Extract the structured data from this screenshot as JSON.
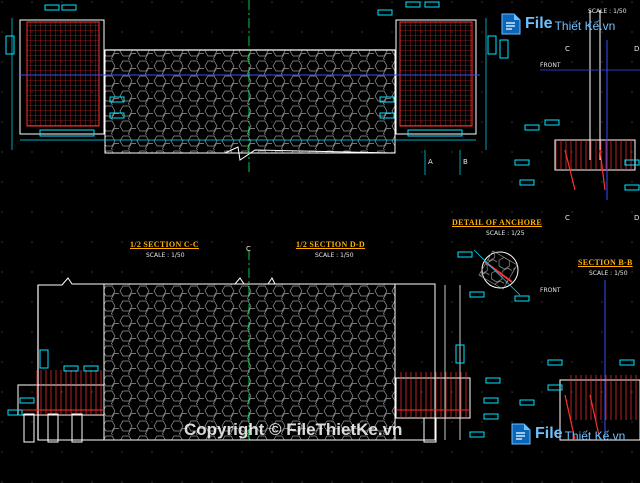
{
  "drawing": {
    "labels": {
      "section_cc": "1/2 SECTION C-C",
      "section_dd": "1/2 SECTION D-D",
      "section_cc_scale": "SCALE : 1/50",
      "section_dd_scale": "SCALE : 1/50",
      "anchore_title": "DETAIL OF ANCHORE",
      "anchore_scale": "SCALE : 1/25",
      "section_bb": "SECTION B-B",
      "section_bb_scale": "SCALE : 1/50",
      "top_right_scale": "SCALE : 1/50",
      "front_top": "FRONT",
      "front_bottom": "FRONT",
      "mark_a": "A",
      "mark_b": "B",
      "mark_c_top": "C",
      "mark_c_mid": "C",
      "mark_d_top": "D",
      "mark_d_mid": "D",
      "mark_c_axis": "C"
    },
    "colors": {
      "background": "#000000",
      "outline": "#ffffff",
      "rebar": "#ff2a2a",
      "dimension": "#00e5ff",
      "axis": "#00ff44",
      "title": "#ffb000",
      "hatch": "#9a9a9a",
      "blue_line": "#3a4cff"
    }
  },
  "watermark": {
    "copyright": "Copyright © FileThietKe.vn",
    "logo_word": "File",
    "logo_word2": "Thiết Kế.vn",
    "logo_icon": "file-thietke-logo-icon"
  }
}
